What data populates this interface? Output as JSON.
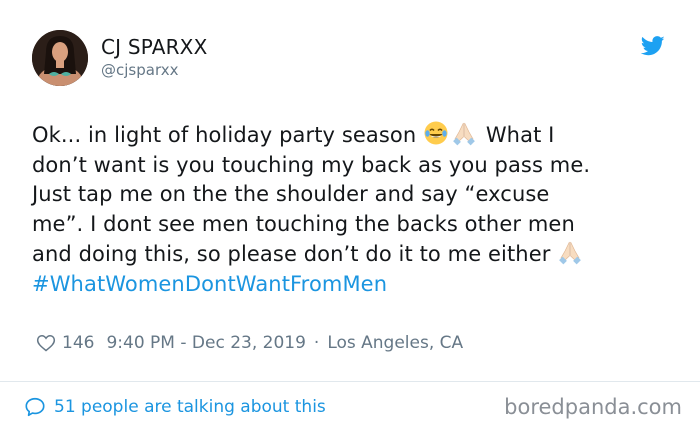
{
  "user": {
    "name": "CJ SPARXX",
    "handle": "@cjsparxx"
  },
  "header": {
    "brand_icon": "twitter-bird-icon",
    "brand_color": "#1da1f2"
  },
  "tweet": {
    "line1_a": "Ok... in light of holiday party season ",
    "line1_b": " What I",
    "line2": "don’t want is you touching my back as you pass me.",
    "line3": "Just tap me on the the shoulder and say “excuse",
    "line4": "me”. I dont see men touching the backs other men",
    "line5": "and doing this, so please don’t do it to me either ",
    "hashtag": "#WhatWomenDontWantFromMen",
    "emojis": [
      "face-with-tears-of-joy",
      "folded-hands",
      "folded-hands"
    ]
  },
  "meta": {
    "likes": "146",
    "timestamp": "9:40 PM - Dec 23, 2019",
    "separator": "·",
    "location": "Los Angeles, CA"
  },
  "footer": {
    "talking": "51 people are talking about this"
  },
  "watermark": "boredpanda.com",
  "colors": {
    "link": "#1b95e0",
    "muted": "#657786",
    "text": "#14171a"
  }
}
